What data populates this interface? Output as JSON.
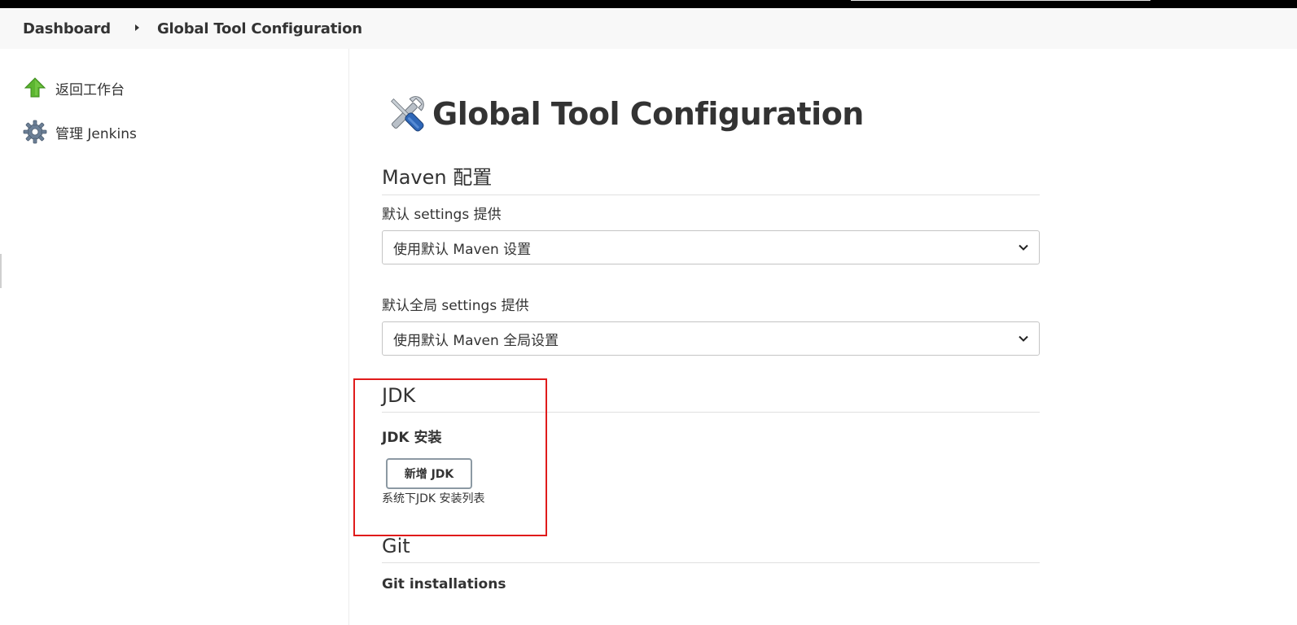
{
  "breadcrumb": {
    "items": [
      "Dashboard",
      "Global Tool Configuration"
    ]
  },
  "sidebar": {
    "items": [
      {
        "label": "返回工作台",
        "icon": "up-arrow-icon",
        "color": "#4caf32"
      },
      {
        "label": "管理 Jenkins",
        "icon": "gear-icon",
        "color": "#6b7f96"
      }
    ]
  },
  "main": {
    "title": "Global Tool Configuration",
    "title_icon": "tools-icon",
    "maven": {
      "section_title": "Maven 配置",
      "settings_label": "默认 settings 提供",
      "settings_value": "使用默认 Maven 设置",
      "global_settings_label": "默认全局 settings 提供",
      "global_settings_value": "使用默认 Maven 全局设置"
    },
    "jdk": {
      "section_title": "JDK",
      "installations_label": "JDK 安装",
      "add_button": "新增 JDK",
      "help_text": "系统下JDK 安装列表"
    },
    "git": {
      "section_title": "Git",
      "installations_label": "Git installations"
    }
  },
  "annotation": {
    "highlight_color": "#e01b1b"
  }
}
